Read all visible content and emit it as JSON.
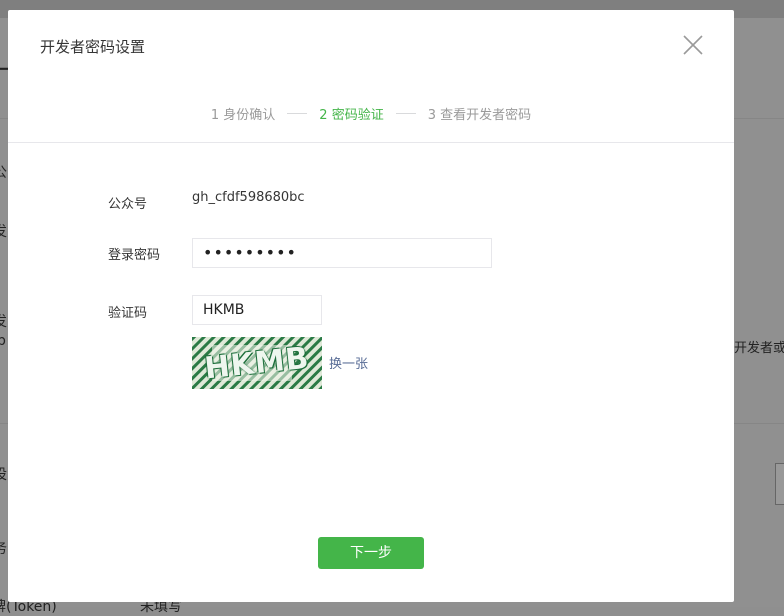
{
  "background": {
    "fragments": [
      "一",
      "公",
      "发",
      "发",
      "p",
      "开发者或",
      "设",
      "务",
      "牌(Token)",
      "未填写"
    ]
  },
  "dialog": {
    "title": "开发者密码设置",
    "steps": [
      {
        "label": "1 身份确认"
      },
      {
        "label": "2 密码验证"
      },
      {
        "label": "3 查看开发者密码"
      }
    ],
    "active_step": 2,
    "form": {
      "account_label": "公众号",
      "account_value": "gh_cfdf598680bc",
      "password_label": "登录密码",
      "password_value": "•••••••••",
      "captcha_label": "验证码",
      "captcha_value": "HKMB",
      "captcha_image_text": "HKMB",
      "refresh_label": "换一张"
    },
    "next_button": "下一步"
  },
  "colors": {
    "accent": "#44b549",
    "link": "#576b95",
    "muted": "#9a9a9a"
  }
}
